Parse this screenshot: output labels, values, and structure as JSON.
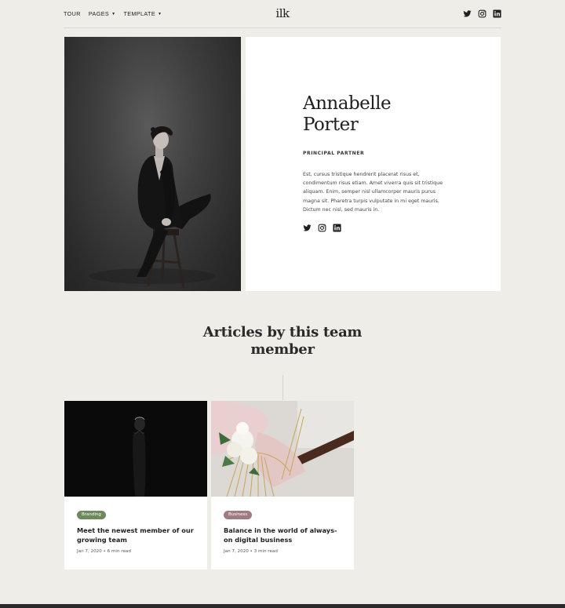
{
  "nav": {
    "items": [
      {
        "label": "TOUR"
      },
      {
        "label": "PAGES"
      },
      {
        "label": "TEMPLATE"
      }
    ],
    "logo": "ilk",
    "social_icons": [
      "twitter-icon",
      "instagram-icon",
      "linkedin-icon"
    ]
  },
  "profile": {
    "name_line1": "Annabelle",
    "name_line2": "Porter",
    "role": "PRINCIPAL PARTNER",
    "bio": "Est, cursus tristique hendrerit placerat risus et, condimentum risus etiam. Amet viverra quis sit tristique aliquam. Enim, semper nisl ullamcorper mauris purus magna sit. Pharetra turpis vulputate in mi eget mauris. Dictum nec nisl, sed mauris in.",
    "social_icons": [
      "twitter-icon",
      "instagram-icon",
      "linkedin-icon"
    ]
  },
  "articles_section": {
    "title_line1": "Articles by this team",
    "title_line2": "member"
  },
  "articles": [
    {
      "tag": "Branding",
      "tag_color": "#6d8a5d",
      "title": "Meet the newest member of our growing team",
      "meta": "Jan 7, 2020 • 6 min read"
    },
    {
      "tag": "Business",
      "tag_color": "#a07b80",
      "title": "Balance in the world of always-on digital business",
      "meta": "Jan 7, 2020 • 3 min read"
    }
  ],
  "colors": {
    "background": "#efede8",
    "card": "#ffffff",
    "text": "#222222"
  }
}
